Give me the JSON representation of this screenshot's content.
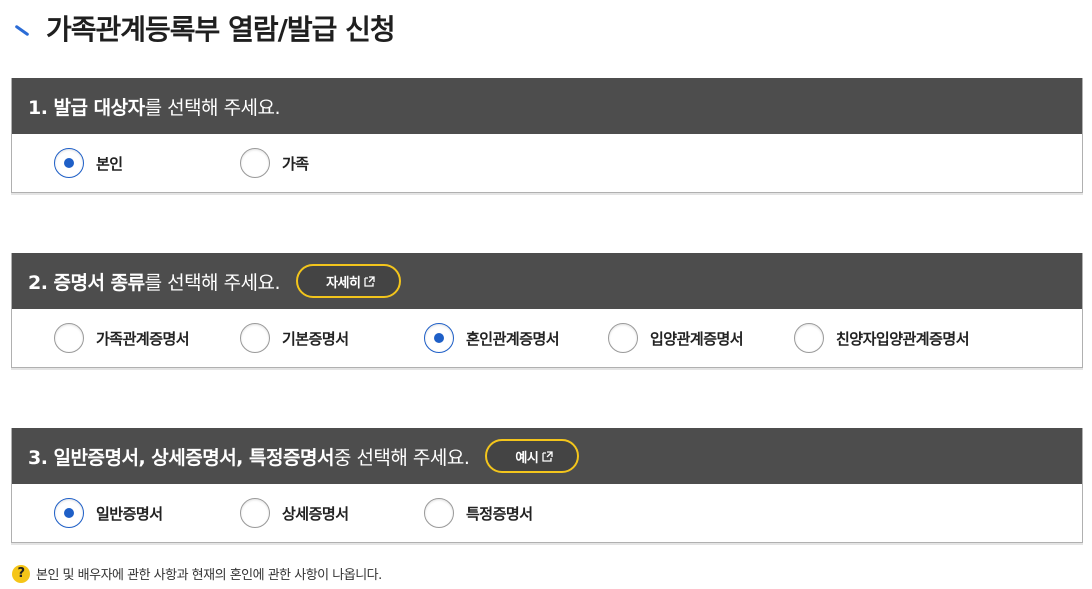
{
  "page": {
    "title": "가족관계등록부 열람/발급 신청"
  },
  "sections": [
    {
      "header_bold": "1. 발급 대상자",
      "header_rest": "를 선택해 주세요.",
      "options": [
        {
          "label": "본인",
          "checked": true
        },
        {
          "label": "가족",
          "checked": false
        }
      ]
    },
    {
      "header_bold": "2. 증명서 종류",
      "header_rest": "를 선택해 주세요.",
      "pill_label": "자세히",
      "options": [
        {
          "label": "가족관계증명서",
          "checked": false
        },
        {
          "label": "기본증명서",
          "checked": false
        },
        {
          "label": "혼인관계증명서",
          "checked": true
        },
        {
          "label": "입양관계증명서",
          "checked": false
        },
        {
          "label": "친양자입양관계증명서",
          "checked": false
        }
      ]
    },
    {
      "header_bold": "3. 일반증명서, 상세증명서, 특정증명서",
      "header_rest": " 중 선택해 주세요.",
      "pill_label": "예시",
      "options": [
        {
          "label": "일반증명서",
          "checked": true
        },
        {
          "label": "상세증명서",
          "checked": false
        },
        {
          "label": "특정증명서",
          "checked": false
        }
      ]
    }
  ],
  "note": {
    "icon": "?",
    "text": "본인 및 배우자에 관한 사항과 현재의 혼인에 관한 사항이 나옵니다."
  },
  "colors": {
    "header_bg": "#4d4d4d",
    "radio_checked": "#1e5fc7",
    "pill_border": "#f3c51c",
    "title_mark": "#2b6cd6",
    "help_icon": "#f5c518"
  }
}
